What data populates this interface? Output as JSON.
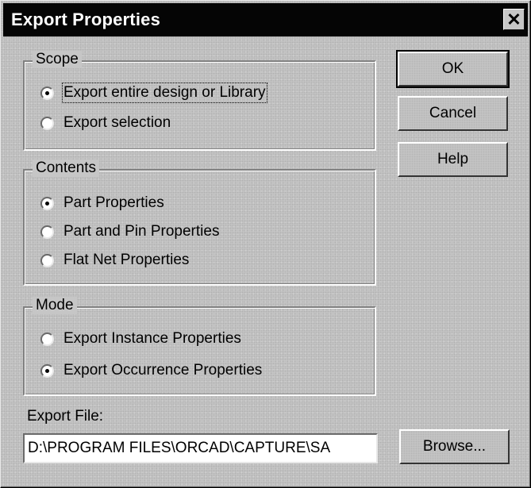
{
  "dialog": {
    "title": "Export Properties",
    "close_glyph": "✕"
  },
  "scope": {
    "legend": "Scope",
    "options": [
      {
        "label": "Export entire design or Library",
        "checked": true
      },
      {
        "label": "Export selection",
        "checked": false
      }
    ]
  },
  "contents": {
    "legend": "Contents",
    "options": [
      {
        "label": "Part Properties",
        "checked": true
      },
      {
        "label": "Part and Pin Properties",
        "checked": false
      },
      {
        "label": "Flat Net Properties",
        "checked": false
      }
    ]
  },
  "mode": {
    "legend": "Mode",
    "options": [
      {
        "label": "Export Instance Properties",
        "checked": false
      },
      {
        "label": "Export Occurrence Properties",
        "checked": true
      }
    ]
  },
  "buttons": {
    "ok": "OK",
    "cancel": "Cancel",
    "help": "Help",
    "browse": "Browse..."
  },
  "export_file": {
    "label": "Export File:",
    "value": "D:\\PROGRAM FILES\\ORCAD\\CAPTURE\\SA"
  }
}
